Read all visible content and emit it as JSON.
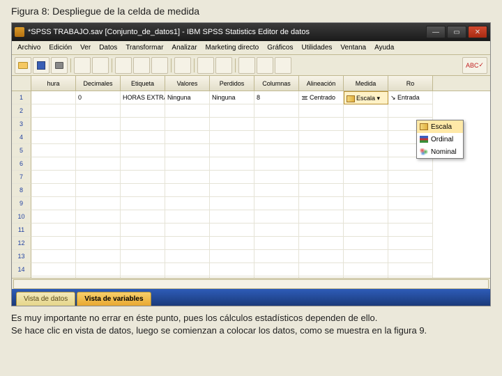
{
  "caption": "Figura 8: Despliegue de la celda de medida",
  "titlebar": {
    "text": "*SPSS TRABAJO.sav [Conjunto_de_datos1] - IBM SPSS Statistics Editor de datos"
  },
  "menu": [
    "Archivo",
    "Edición",
    "Ver",
    "Datos",
    "Transformar",
    "Analizar",
    "Marketing directo",
    "Gráficos",
    "Utilidades",
    "Ventana",
    "Ayuda"
  ],
  "columns": [
    "hura",
    "Decimales",
    "Etiqueta",
    "Valores",
    "Perdidos",
    "Columnas",
    "Alineación",
    "Medida",
    "Ro"
  ],
  "row1": {
    "decimales": "0",
    "etiqueta": "HORAS EXTRAS",
    "valores": "Ninguna",
    "perdidos": "Ninguna",
    "columnas": "8",
    "alineacion": "Centrado",
    "medida": "Escala",
    "rol": "Entrada"
  },
  "dropdown": {
    "items": [
      "Escala",
      "Ordinal",
      "Nominal"
    ],
    "selected": "Escala"
  },
  "tabs": {
    "datos": "Vista de datos",
    "variables": "Vista de variables"
  },
  "footer": {
    "p1": "Es muy importante no errar en éste punto, pues los cálculos estadísticos dependen de ello.",
    "p2": "Se hace clic en vista de datos, luego se comienzan a colocar los datos, como se muestra en la figura 9."
  },
  "abc_label": "ABC"
}
